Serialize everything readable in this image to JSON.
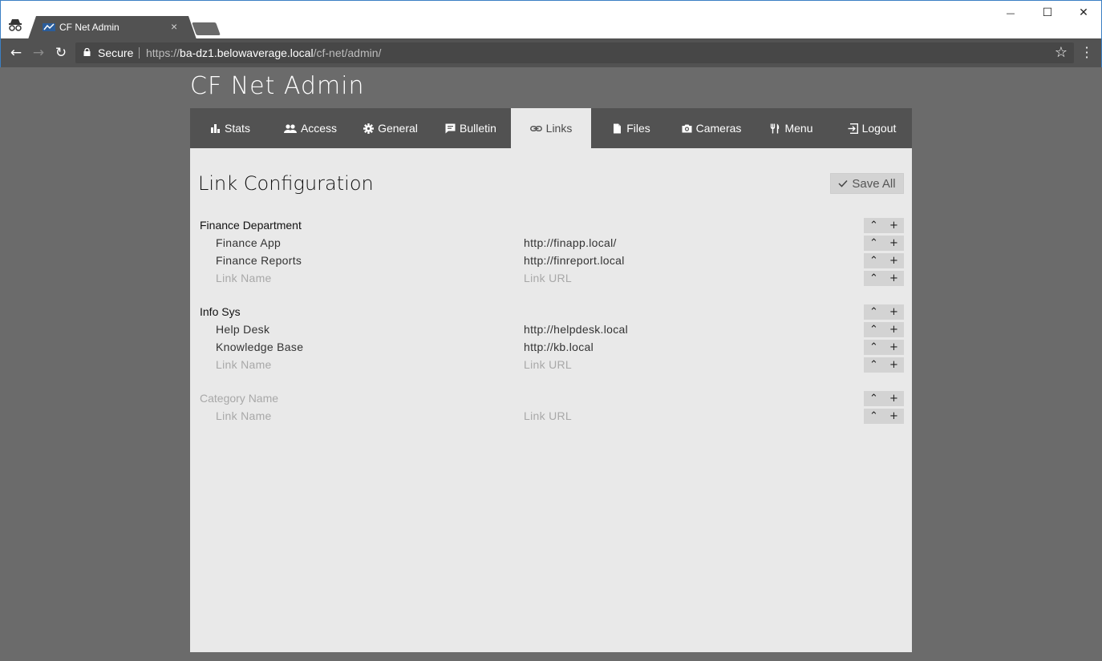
{
  "browser": {
    "tab_title": "CF Net Admin",
    "tab_close": "×",
    "secure_label": "Secure",
    "url_scheme": "https://",
    "url_host": "ba-dz1.belowaverage.local",
    "url_path": "/cf-net/admin/",
    "window_controls": {
      "minimize": "—",
      "maximize": "☐",
      "close": "✕"
    },
    "nav": {
      "back": "←",
      "forward": "→",
      "reload": "↻"
    },
    "bookmark_star": "☆"
  },
  "app": {
    "title": "CF Net Admin",
    "nav": [
      {
        "label": "Stats",
        "icon": "bar-chart-icon"
      },
      {
        "label": "Access",
        "icon": "users-icon"
      },
      {
        "label": "General",
        "icon": "gear-icon"
      },
      {
        "label": "Bulletin",
        "icon": "message-icon"
      },
      {
        "label": "Links",
        "icon": "link-icon",
        "active": true
      },
      {
        "label": "Files",
        "icon": "file-icon"
      },
      {
        "label": "Cameras",
        "icon": "camera-icon"
      },
      {
        "label": "Menu",
        "icon": "utensils-icon"
      },
      {
        "label": "Logout",
        "icon": "logout-icon"
      }
    ]
  },
  "page": {
    "heading": "Link Configuration",
    "save_all_label": "Save All",
    "move_up_glyph": "⌃",
    "add_glyph": "+",
    "categories": [
      {
        "name": "Finance Department",
        "links": [
          {
            "name": "Finance App",
            "url": "http://finapp.local/"
          },
          {
            "name": "Finance Reports",
            "url": "http://finreport.local"
          }
        ],
        "new_link": {
          "name_placeholder": "Link Name",
          "url_placeholder": "Link URL"
        }
      },
      {
        "name": "Info Sys",
        "links": [
          {
            "name": "Help Desk",
            "url": "http://helpdesk.local"
          },
          {
            "name": "Knowledge Base",
            "url": "http://kb.local"
          }
        ],
        "new_link": {
          "name_placeholder": "Link Name",
          "url_placeholder": "Link URL"
        }
      }
    ],
    "new_category": {
      "name_placeholder": "Category Name",
      "new_link": {
        "name_placeholder": "Link Name",
        "url_placeholder": "Link URL"
      }
    }
  },
  "colors": {
    "page_background": "#6b6b6b",
    "nav_background": "#525252",
    "panel_background": "#e9e9e9",
    "button_background": "#d3d3d3"
  }
}
